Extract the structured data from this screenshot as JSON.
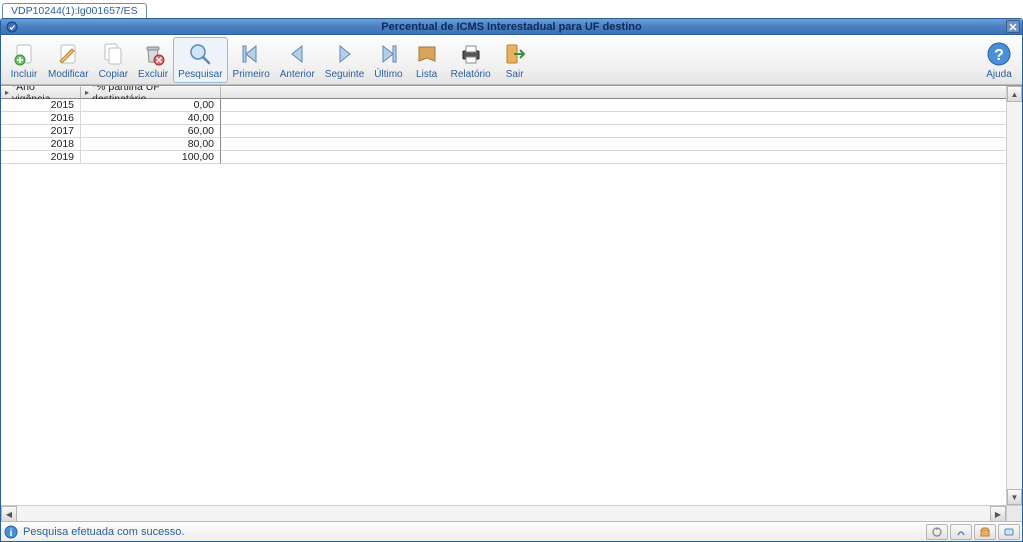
{
  "tab": {
    "label": "VDP10244(1):lg001657/ES"
  },
  "window": {
    "title": "Percentual de ICMS Interestadual para UF destino"
  },
  "toolbar": {
    "incluir": "Incluir",
    "modificar": "Modificar",
    "copiar": "Copiar",
    "excluir": "Excluir",
    "pesquisar": "Pesquisar",
    "primeiro": "Primeiro",
    "anterior": "Anterior",
    "seguinte": "Seguinte",
    "ultimo": "Último",
    "lista": "Lista",
    "relatorio": "Relatório",
    "sair": "Sair",
    "ajuda": "Ajuda"
  },
  "grid": {
    "columns": {
      "ano": "*Ano vigência",
      "partilha": "*% partilha UF destinatário"
    },
    "rows": [
      {
        "ano": "2015",
        "partilha": "0,00"
      },
      {
        "ano": "2016",
        "partilha": "40,00"
      },
      {
        "ano": "2017",
        "partilha": "60,00"
      },
      {
        "ano": "2018",
        "partilha": "80,00"
      },
      {
        "ano": "2019",
        "partilha": "100,00"
      }
    ]
  },
  "status": {
    "message": "Pesquisa efetuada com sucesso."
  }
}
